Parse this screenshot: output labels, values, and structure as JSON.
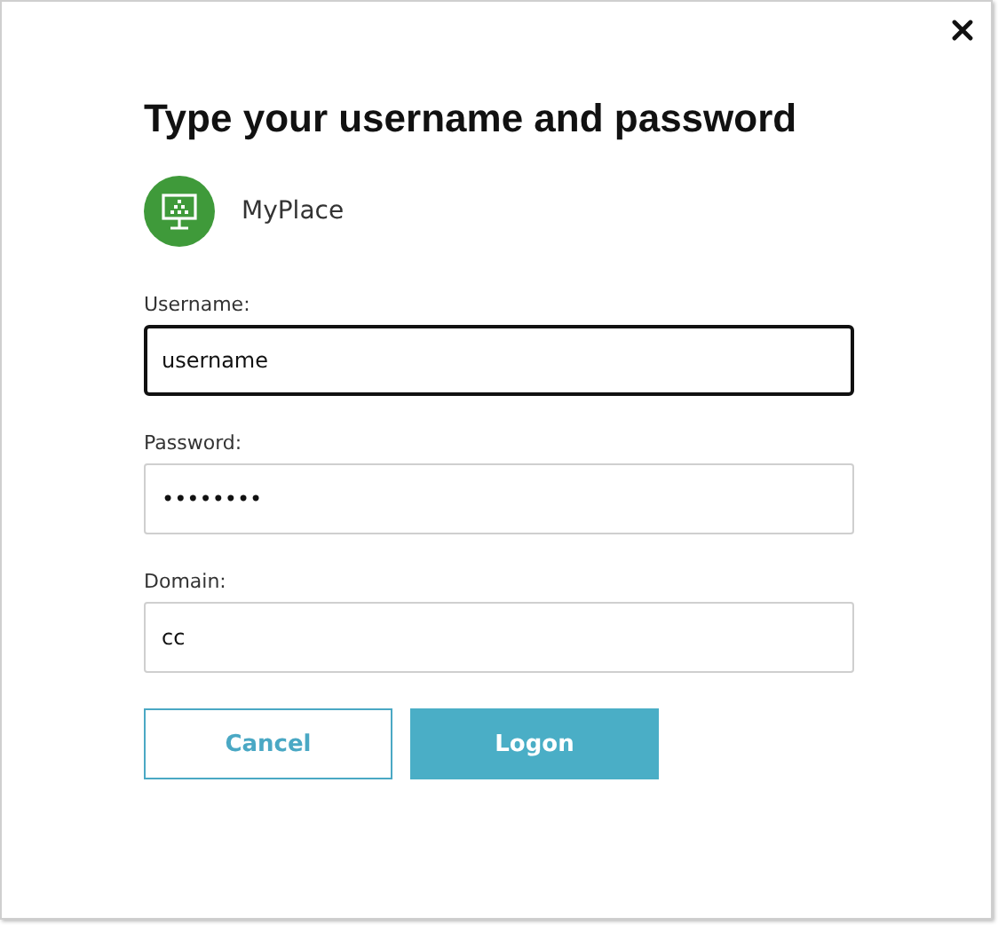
{
  "dialog": {
    "title": "Type your username and password"
  },
  "app": {
    "name": "MyPlace"
  },
  "fields": [
    {
      "label": "Username:",
      "value": "username",
      "focused": true
    },
    {
      "label": "Password:",
      "value": "••••••••",
      "focused": false
    },
    {
      "label": "Domain:",
      "value": "cc",
      "focused": false
    }
  ],
  "buttons": [
    {
      "label": "Cancel",
      "kind": "secondary"
    },
    {
      "label": "Logon",
      "kind": "primary"
    }
  ]
}
